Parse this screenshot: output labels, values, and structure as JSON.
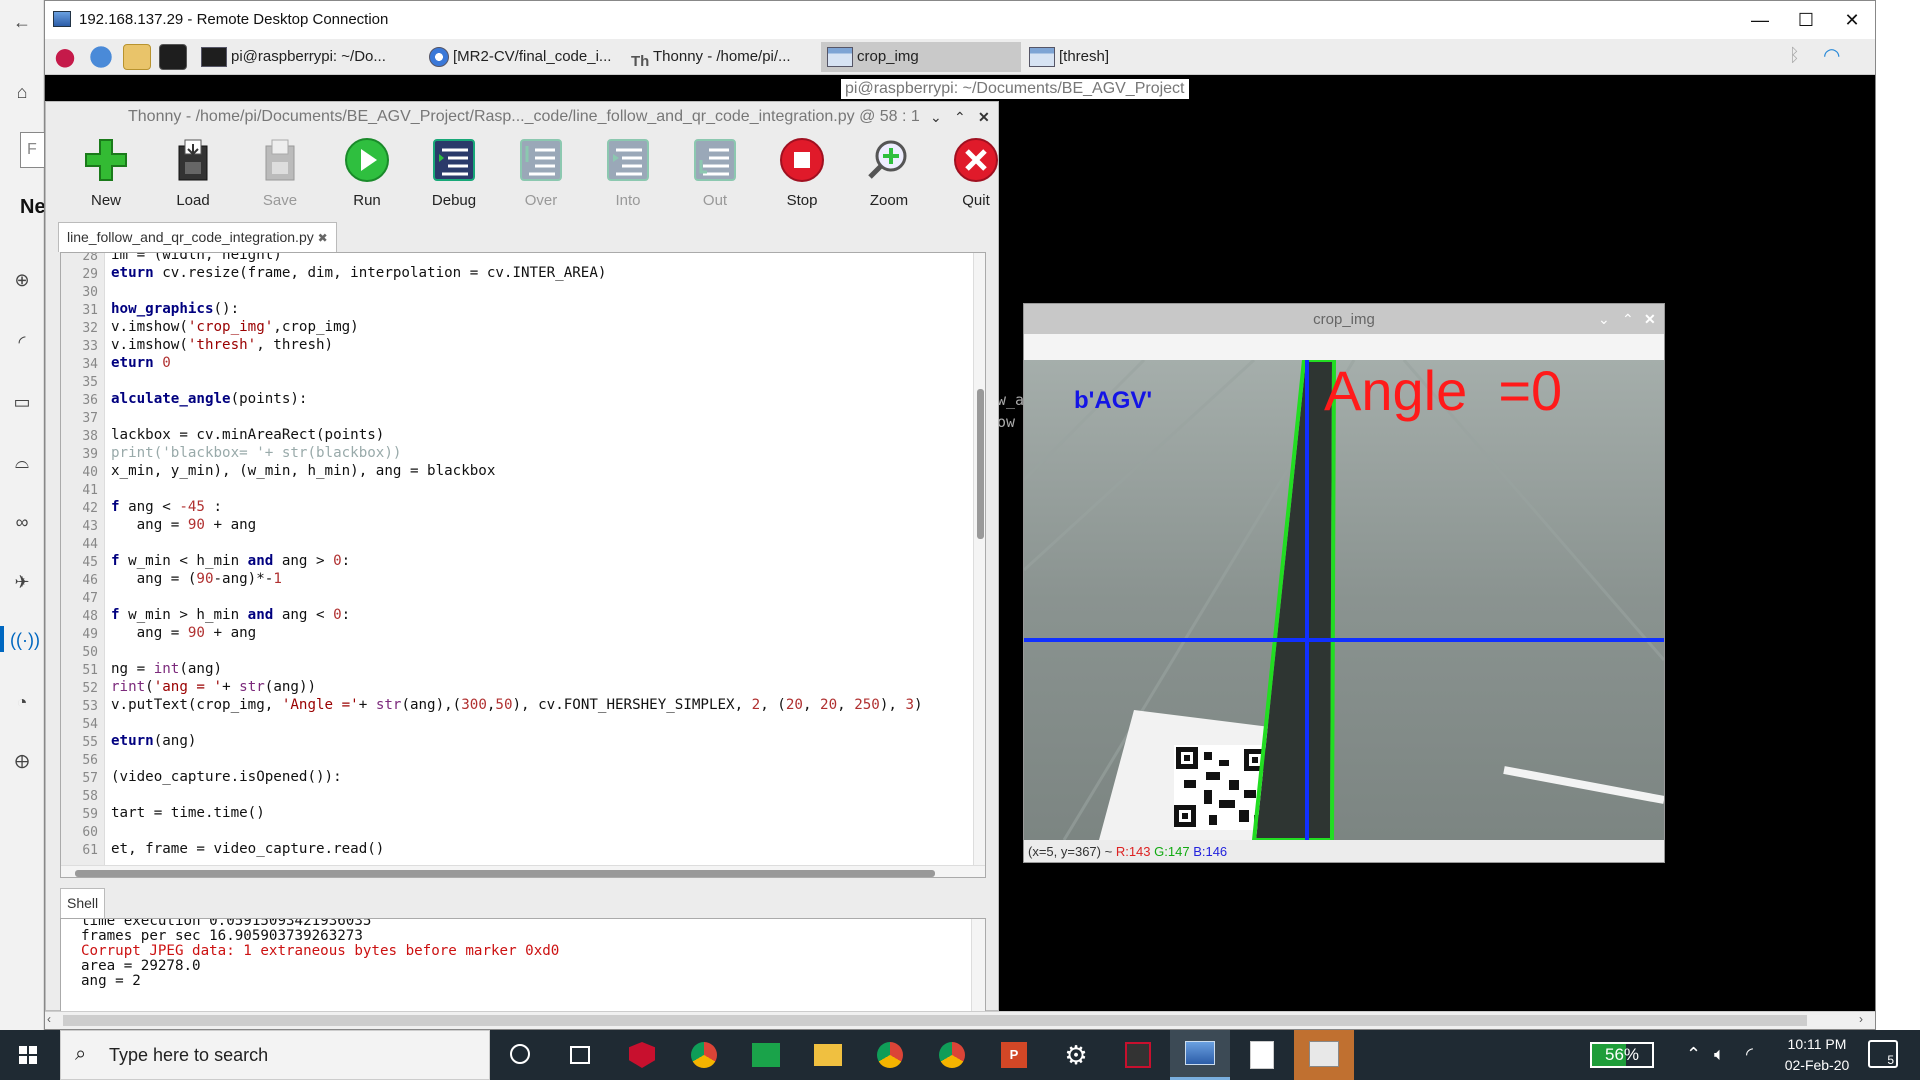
{
  "host": {
    "partial_heading": "Ne",
    "partial_field": "F"
  },
  "rdc": {
    "title": "192.168.137.29 - Remote Desktop Connection",
    "minimize": "—",
    "maximize": "☐",
    "close": "✕"
  },
  "pi_panel": {
    "tasks": [
      {
        "label": "pi@raspberrypi: ~/Do...",
        "icon": "terminal-icon"
      },
      {
        "label": "[MR2-CV/final_code_i...",
        "icon": "chromium-icon"
      },
      {
        "label": "Thonny  -  /home/pi/...",
        "icon": "thonny-icon"
      },
      {
        "label": "crop_img",
        "icon": "window-icon"
      },
      {
        "label": "[thresh]",
        "icon": "window-icon"
      }
    ],
    "tooltip": "pi@raspberrypi: ~/Documents/BE_AGV_Project"
  },
  "thonny": {
    "title": "Thonny  -  /home/pi/Documents/BE_AGV_Project/Rasp..._code/line_follow_and_qr_code_integration.py  @  58 : 1",
    "toolbar": [
      {
        "label": "New",
        "icon": "new-plus-icon",
        "enabled": true
      },
      {
        "label": "Load",
        "icon": "load-icon",
        "enabled": true
      },
      {
        "label": "Save",
        "icon": "save-icon",
        "enabled": false
      },
      {
        "label": "Run",
        "icon": "run-icon",
        "enabled": true
      },
      {
        "label": "Debug",
        "icon": "debug-icon",
        "enabled": true
      },
      {
        "label": "Over",
        "icon": "step-over-icon",
        "enabled": false
      },
      {
        "label": "Into",
        "icon": "step-into-icon",
        "enabled": false
      },
      {
        "label": "Out",
        "icon": "step-out-icon",
        "enabled": false
      },
      {
        "label": "Stop",
        "icon": "stop-icon",
        "enabled": true
      },
      {
        "label": "Zoom",
        "icon": "zoom-icon",
        "enabled": true
      },
      {
        "label": "Quit",
        "icon": "quit-icon",
        "enabled": true
      }
    ],
    "editor_tab": "line_follow_and_qr_code_integration.py",
    "editor_tab_close": "✖",
    "code_lines": [
      {
        "n": "28",
        "tokens": [
          [
            "",
            "im = (width, height)"
          ]
        ]
      },
      {
        "n": "29",
        "tokens": [
          [
            "kw",
            "eturn"
          ],
          [
            "",
            " cv.resize(frame, dim, interpolation = cv.INTER_AREA)"
          ]
        ]
      },
      {
        "n": "30",
        "tokens": []
      },
      {
        "n": "31",
        "tokens": [
          [
            "fn",
            "how_graphics"
          ],
          [
            "",
            "():"
          ]
        ]
      },
      {
        "n": "32",
        "tokens": [
          [
            "",
            "v.imshow("
          ],
          [
            "str",
            "'crop_img'"
          ],
          [
            "",
            ",crop_img)"
          ]
        ]
      },
      {
        "n": "33",
        "tokens": [
          [
            "",
            "v.imshow("
          ],
          [
            "str",
            "'thresh'"
          ],
          [
            "",
            ", thresh)"
          ]
        ]
      },
      {
        "n": "34",
        "tokens": [
          [
            "kw",
            "eturn"
          ],
          [
            "",
            " "
          ],
          [
            "num",
            "0"
          ]
        ]
      },
      {
        "n": "35",
        "tokens": []
      },
      {
        "n": "36",
        "tokens": [
          [
            "fn",
            "alculate_angle"
          ],
          [
            "",
            "(points):"
          ]
        ]
      },
      {
        "n": "37",
        "tokens": []
      },
      {
        "n": "38",
        "tokens": [
          [
            "",
            "lackbox = cv.minAreaRect(points)"
          ]
        ]
      },
      {
        "n": "39",
        "tokens": [
          [
            "cmt",
            "print('blackbox= '+ str(blackbox))"
          ]
        ]
      },
      {
        "n": "40",
        "tokens": [
          [
            "",
            "x_min, y_min), (w_min, h_min), ang = blackbox"
          ]
        ]
      },
      {
        "n": "41",
        "tokens": []
      },
      {
        "n": "42",
        "tokens": [
          [
            "kw",
            "f"
          ],
          [
            "",
            " ang < "
          ],
          [
            "num",
            "-45"
          ],
          [
            "",
            " :"
          ]
        ]
      },
      {
        "n": "43",
        "tokens": [
          [
            "",
            "   ang = "
          ],
          [
            "num",
            "90"
          ],
          [
            "",
            " + ang"
          ]
        ]
      },
      {
        "n": "44",
        "tokens": []
      },
      {
        "n": "45",
        "tokens": [
          [
            "kw",
            "f"
          ],
          [
            "",
            " w_min < h_min "
          ],
          [
            "kw",
            "and"
          ],
          [
            "",
            " ang > "
          ],
          [
            "num",
            "0"
          ],
          [
            "",
            ":"
          ]
        ]
      },
      {
        "n": "46",
        "tokens": [
          [
            "",
            "   ang = ("
          ],
          [
            "num",
            "90"
          ],
          [
            "",
            "-ang)*-"
          ],
          [
            "num",
            "1"
          ]
        ]
      },
      {
        "n": "47",
        "tokens": []
      },
      {
        "n": "48",
        "tokens": [
          [
            "kw",
            "f"
          ],
          [
            "",
            " w_min > h_min "
          ],
          [
            "kw",
            "and"
          ],
          [
            "",
            " ang < "
          ],
          [
            "num",
            "0"
          ],
          [
            "",
            ":"
          ]
        ]
      },
      {
        "n": "49",
        "tokens": [
          [
            "",
            "   ang = "
          ],
          [
            "num",
            "90"
          ],
          [
            "",
            " + ang"
          ]
        ]
      },
      {
        "n": "50",
        "tokens": []
      },
      {
        "n": "51",
        "tokens": [
          [
            "",
            "ng = "
          ],
          [
            "bi",
            "int"
          ],
          [
            "",
            "(ang)"
          ]
        ]
      },
      {
        "n": "52",
        "tokens": [
          [
            "bi",
            "rint"
          ],
          [
            "",
            "("
          ],
          [
            "str",
            "'ang = '"
          ],
          [
            "",
            "+ "
          ],
          [
            "bi",
            "str"
          ],
          [
            "",
            "(ang))"
          ]
        ]
      },
      {
        "n": "53",
        "tokens": [
          [
            "",
            "v.putText(crop_img, "
          ],
          [
            "str",
            "'Angle ='"
          ],
          [
            "",
            "+ "
          ],
          [
            "bi",
            "str"
          ],
          [
            "",
            "(ang),("
          ],
          [
            "num",
            "300"
          ],
          [
            "",
            ","
          ],
          [
            "num",
            "50"
          ],
          [
            "",
            "), cv.FONT_HERSHEY_SIMPLEX, "
          ],
          [
            "num",
            "2"
          ],
          [
            "",
            ", ("
          ],
          [
            "num",
            "20"
          ],
          [
            "",
            ", "
          ],
          [
            "num",
            "20"
          ],
          [
            "",
            ", "
          ],
          [
            "num",
            "250"
          ],
          [
            "",
            "), "
          ],
          [
            "num",
            "3"
          ],
          [
            "",
            ")"
          ]
        ]
      },
      {
        "n": "54",
        "tokens": []
      },
      {
        "n": "55",
        "tokens": [
          [
            "kw",
            "eturn"
          ],
          [
            "",
            "(ang)"
          ]
        ]
      },
      {
        "n": "56",
        "tokens": []
      },
      {
        "n": "57",
        "tokens": [
          [
            "",
            "(video_capture.isOpened()):"
          ]
        ]
      },
      {
        "n": "58",
        "tokens": []
      },
      {
        "n": "59",
        "tokens": [
          [
            "",
            "tart = time.time()"
          ]
        ]
      },
      {
        "n": "60",
        "tokens": []
      },
      {
        "n": "61",
        "tokens": [
          [
            "",
            "et, frame = video_capture.read()"
          ]
        ]
      }
    ],
    "shell_tab": "Shell",
    "shell_lines": [
      {
        "text": "time execution 0.059150934219360​35",
        "err": false
      },
      {
        "text": "frames per sec 16.905903739263273",
        "err": false
      },
      {
        "text": "Corrupt JPEG data: 1 extraneous bytes before marker 0xd0",
        "err": true
      },
      {
        "text": "area = 29278.0",
        "err": false
      },
      {
        "text": "ang = 2",
        "err": false
      }
    ]
  },
  "crop_window": {
    "title": "crop_img",
    "overlay_label": "b'AGV'",
    "angle_text": "Angle  =0",
    "status_coords": "(x=5, y=367) ~ ",
    "status_r": "R:143",
    "status_g": "G:147",
    "status_b": "B:146",
    "behind_text_1": "w_a",
    "behind_text_2": "ow"
  },
  "taskbar": {
    "search_placeholder": "Type here to search",
    "battery": "56%",
    "battery_level": 0.56,
    "time": "10:11 PM",
    "date": "02-Feb-20",
    "notifications": "5"
  },
  "colors": {
    "accent_blue": "#0067c0",
    "crosshair": "#1030ff",
    "contour": "#22dd22",
    "angle_text": "#ff1a1a",
    "agv_text": "#1414e6",
    "run_green": "#2fbf3f",
    "stop_red": "#e01a2a"
  }
}
